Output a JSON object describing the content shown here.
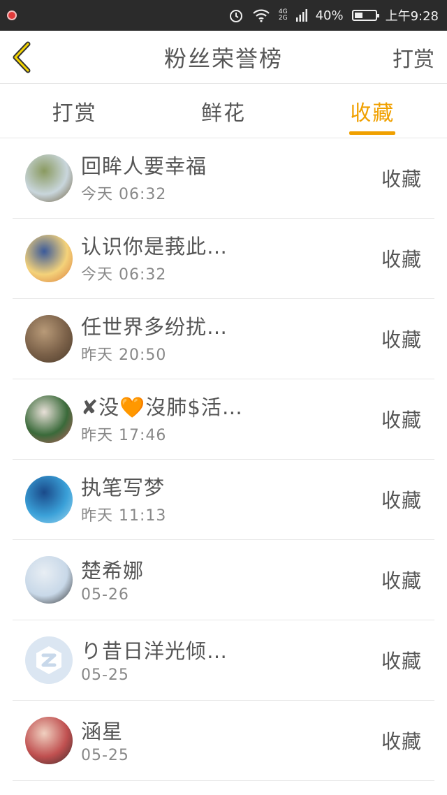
{
  "status_bar": {
    "network_top": "4G",
    "network_bottom": "2G",
    "battery_percent": "40%",
    "battery_level": 0.4,
    "time": "上午9:28"
  },
  "header": {
    "back_icon": "chevron-left-icon",
    "title": "粉丝荣誉榜",
    "right_action": "打赏"
  },
  "tabs": [
    {
      "label": "打赏",
      "active": false
    },
    {
      "label": "鲜花",
      "active": false
    },
    {
      "label": "收藏",
      "active": true
    }
  ],
  "colors": {
    "accent": "#f0a000",
    "status_bar_bg": "#2b2b2b"
  },
  "items": [
    {
      "name": "回眸人要幸福",
      "time": "今天  06:32",
      "action": "收藏",
      "avatar_colors": [
        "#c9d6dc",
        "#8a9a60",
        "#6b5a38"
      ]
    },
    {
      "name": "认识你是莪此…",
      "time": "今天  06:32",
      "action": "收藏",
      "avatar_colors": [
        "#f4d27a",
        "#3b5a9a",
        "#d97a3a"
      ]
    },
    {
      "name": "任世界多纷扰…",
      "time": "昨天  20:50",
      "action": "收藏",
      "avatar_colors": [
        "#7a6048",
        "#b89a78",
        "#4a3a2a"
      ]
    },
    {
      "name": "✘没🧡沒肺$活…",
      "time": "昨天  17:46",
      "action": "收藏",
      "avatar_colors": [
        "#3a6a3a",
        "#e8e0d8",
        "#c06060"
      ]
    },
    {
      "name": "执笔写梦",
      "time": "昨天  11:13",
      "action": "收藏",
      "avatar_colors": [
        "#3aa0d8",
        "#1a4a8a",
        "#a0d8f0"
      ]
    },
    {
      "name": "楚希娜",
      "time": "05-26",
      "action": "收藏",
      "avatar_colors": [
        "#c8d8e8",
        "#e8eef4",
        "#2a2a2a"
      ]
    },
    {
      "name": "り昔日洋光倾…",
      "time": "05-25",
      "action": "收藏",
      "avatar_colors": [
        "#dbe6f2",
        "#dbe6f2",
        "#ffffff"
      ]
    },
    {
      "name": "涵星",
      "time": "05-25",
      "action": "收藏",
      "avatar_colors": [
        "#c05050",
        "#f0d0c0",
        "#3a2a2a"
      ]
    }
  ]
}
